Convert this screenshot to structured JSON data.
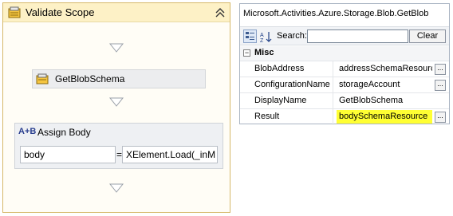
{
  "workflow": {
    "scope_title": "Validate Scope",
    "scope_icon": "scope-icon",
    "collapse_icon": "collapse-up-icon",
    "activity": {
      "label": "GetBlobSchema",
      "icon": "activity-icon"
    },
    "assign": {
      "icon_text": "A+B",
      "title": "Assign Body",
      "to_value": "body",
      "equals": "=",
      "value_expression": "XElement.Load(_inM"
    },
    "arrow_icon": "drop-arrow-icon"
  },
  "properties": {
    "title": "Microsoft.Activities.Azure.Storage.Blob.GetBlob",
    "search_label": "Search:",
    "search_value": "",
    "clear_label": "Clear",
    "category": {
      "toggle": "−",
      "label": "Misc"
    },
    "rows": [
      {
        "name": "BlobAddress",
        "value": "addressSchemaResource",
        "has_button": true,
        "highlight": false
      },
      {
        "name": "ConfigurationName",
        "value": "storageAccount",
        "has_button": true,
        "highlight": false
      },
      {
        "name": "DisplayName",
        "value": "GetBlobSchema",
        "has_button": false,
        "highlight": false
      },
      {
        "name": "Result",
        "value": "bodySchemaResource",
        "has_button": true,
        "highlight": true
      }
    ],
    "ellipsis_label": "...",
    "highlight_color": "#ffff33"
  }
}
